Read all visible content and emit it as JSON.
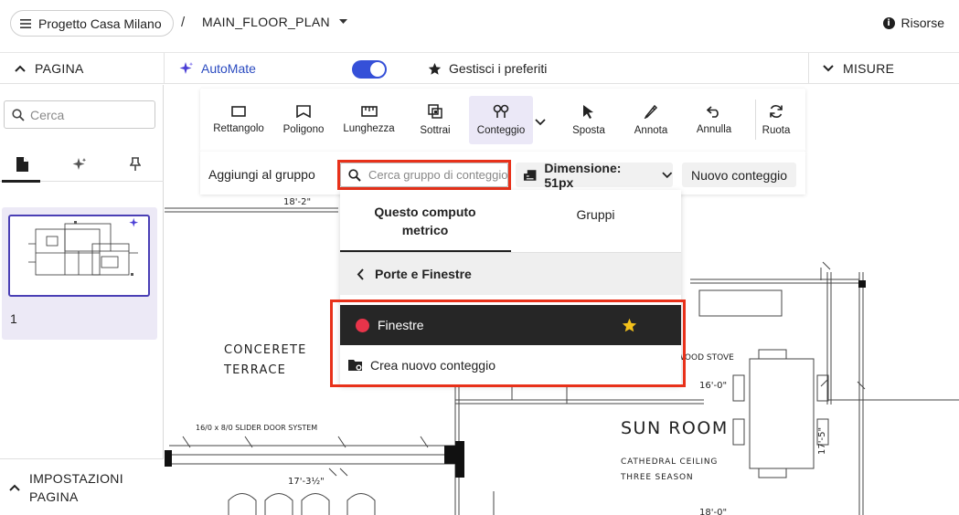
{
  "topbar": {
    "project_name": "Progetto Casa Milano",
    "separator": "/",
    "plan_name": "MAIN_FLOOR_PLAN",
    "resources_label": "Risorse"
  },
  "secbar": {
    "page_label": "PAGINA",
    "automate_label": "AutoMate",
    "automate_enabled": true,
    "favorites_label": "Gestisci i preferiti",
    "measures_label": "MISURE"
  },
  "sidebar": {
    "search_placeholder": "Cerca",
    "tabs": [
      {
        "name": "pages",
        "icon": "document-icon",
        "active": true
      },
      {
        "name": "ai",
        "icon": "sparkle-icon",
        "active": false
      },
      {
        "name": "pinned",
        "icon": "pin-icon",
        "active": false
      }
    ],
    "page_number": "1",
    "page_settings_label": "IMPOSTAZIONI PAGINA"
  },
  "toolbar": {
    "tools": [
      {
        "label": "Rettangolo",
        "icon": "rectangle-icon"
      },
      {
        "label": "Poligono",
        "icon": "polygon-icon"
      },
      {
        "label": "Lunghezza",
        "icon": "ruler-icon"
      },
      {
        "label": "Sottrai",
        "icon": "subtract-icon"
      },
      {
        "label": "Conteggio",
        "icon": "count-icon",
        "active": true
      },
      {
        "label": "Sposta",
        "icon": "cursor-icon"
      },
      {
        "label": "Annota",
        "icon": "pen-icon"
      },
      {
        "label": "Annulla",
        "icon": "undo-icon"
      },
      {
        "label": "Ruota",
        "icon": "rotate-icon"
      }
    ]
  },
  "groupbar": {
    "label": "Aggiungi al gruppo",
    "search_placeholder": "Cerca gruppo di conteggio",
    "dimension_label": "Dimensione: 51px",
    "new_count_label": "Nuovo conteggio"
  },
  "dropdown": {
    "tab_estimate": "Questo computo metrico",
    "tab_groups": "Gruppi",
    "back_label": "Porte e Finestre",
    "items": [
      {
        "label": "Finestre",
        "color": "#e8344a",
        "favorite": true
      },
      {
        "label": "Crea nuovo conteggio",
        "icon": "new-folder-icon"
      }
    ]
  },
  "plan": {
    "labels": {
      "terrace": [
        "CONCERETE",
        "TERRACE"
      ],
      "sun_room": "SUN ROOM",
      "ceiling": "CATHEDRAL CEILING",
      "season": "THREE SEASON",
      "stove": "WOOD STOVE",
      "slider": "16/0 x 8/0 SLIDER DOOR SYSTEM"
    },
    "dimensions": [
      "18'-2\"",
      "16'-0\"",
      "17'-3½\"",
      "18'-0\"",
      "17'-5\""
    ]
  },
  "colors": {
    "accent": "#3550d8",
    "highlight": "#e8311a",
    "active_tool_bg": "#ebe8f7"
  }
}
